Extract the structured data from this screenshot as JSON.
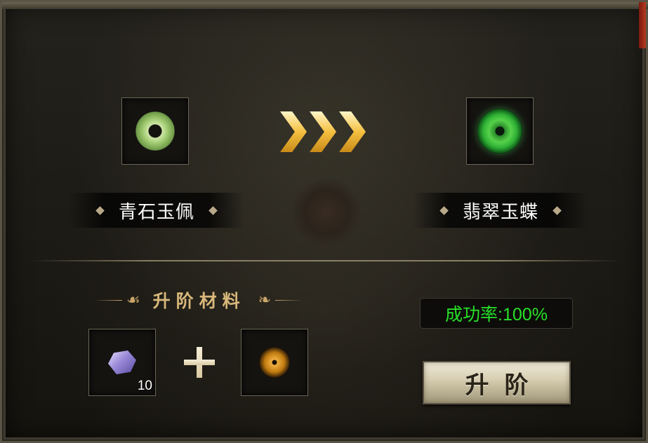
{
  "source_item": {
    "name": "青石玉佩",
    "icon": "jade-disc-icon"
  },
  "target_item": {
    "name": "翡翠玉蝶",
    "icon": "green-jade-butterfly-icon"
  },
  "materials": {
    "title": "升阶材料",
    "items": [
      {
        "icon": "purple-crystal-icon",
        "quantity": "10"
      },
      {
        "icon": "golden-eye-icon",
        "quantity": ""
      }
    ]
  },
  "success_rate": "成功率:100%",
  "upgrade_button": {
    "label": "升阶"
  },
  "colors": {
    "rate_text": "#28e028",
    "title_gold": "#d8b87a",
    "arrow_gold": "#f4c040"
  }
}
